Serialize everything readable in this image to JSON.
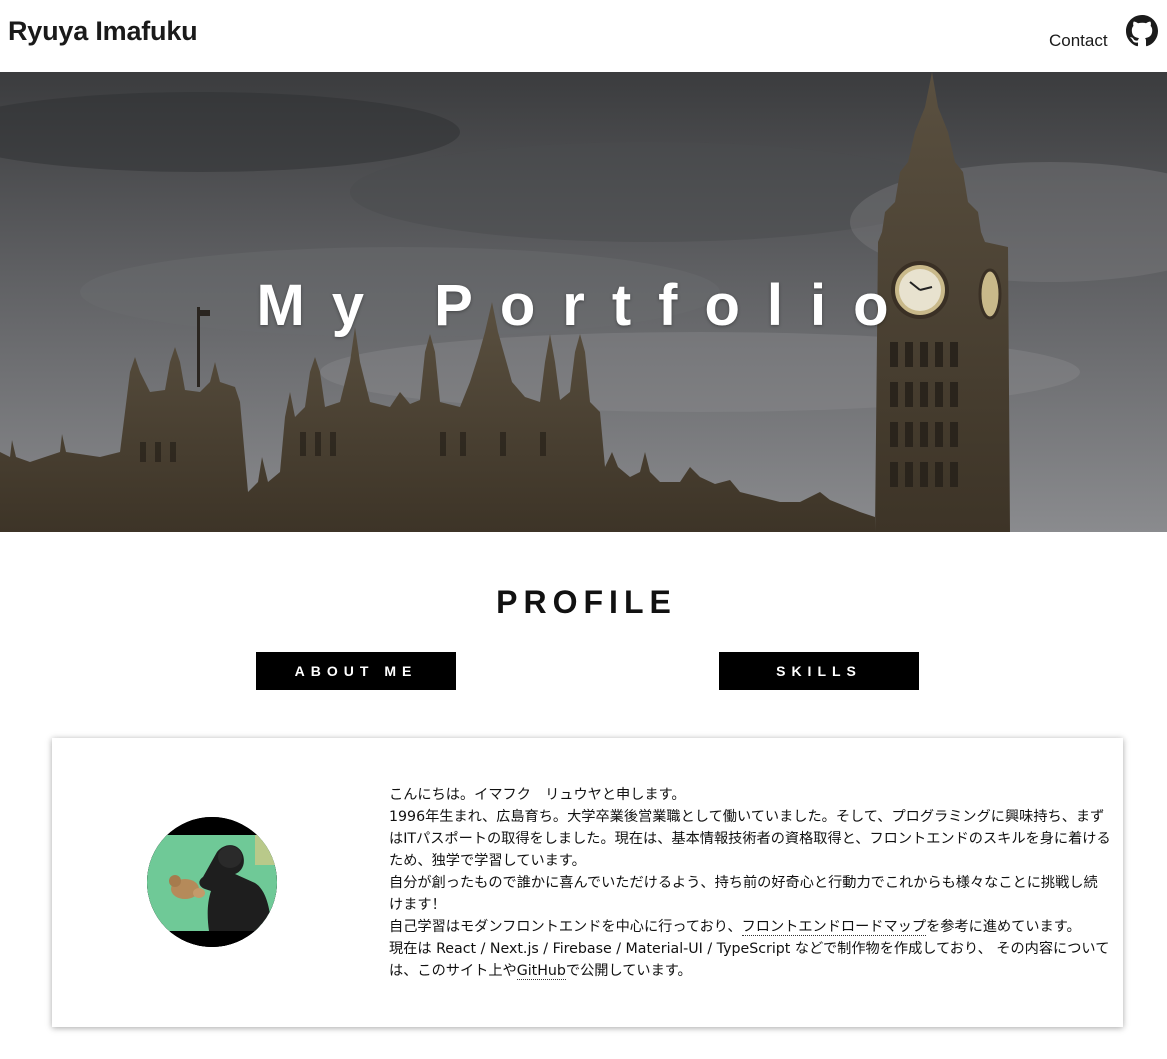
{
  "header": {
    "site_title": "Ryuya Imafuku",
    "contact_label": "Contact",
    "github_icon": "github-icon"
  },
  "hero": {
    "title": "My Portfolio"
  },
  "profile": {
    "heading": "PROFILE",
    "tabs": [
      {
        "label": "ABOUT ME"
      },
      {
        "label": "SKILLS"
      }
    ],
    "bio": {
      "line1": "こんにちは。イマフク　リュウヤと申します。",
      "line2": "1996年生まれ、広島育ち。大学卒業後営業職として働いていました。そして、プログラミングに興味持ち、まずはITパスポートの取得をしました。現在は、基本情報技術者の資格取得と、フロントエンドのスキルを身に着けるため、独学で学習しています。",
      "line3": "自分が創ったもので誰かに喜んでいただけるよう、持ち前の好奇心と行動力でこれからも様々なことに挑戦し続けます！",
      "line4_before": "自己学習はモダンフロントエンドを中心に行っており、",
      "line4_link": "フロントエンドロードマップ",
      "line4_after": "を参考に進めています。",
      "line5_before": "現在は React / Next.js / Firebase / Material-UI / TypeScript などで制作物を作成しており、 その内容については、このサイト上や",
      "line5_link": "GitHub",
      "line5_after": "で公開しています。"
    }
  },
  "colors": {
    "tab_background": "#000000",
    "tab_text": "#ffffff",
    "hero_title": "#ffffff"
  }
}
